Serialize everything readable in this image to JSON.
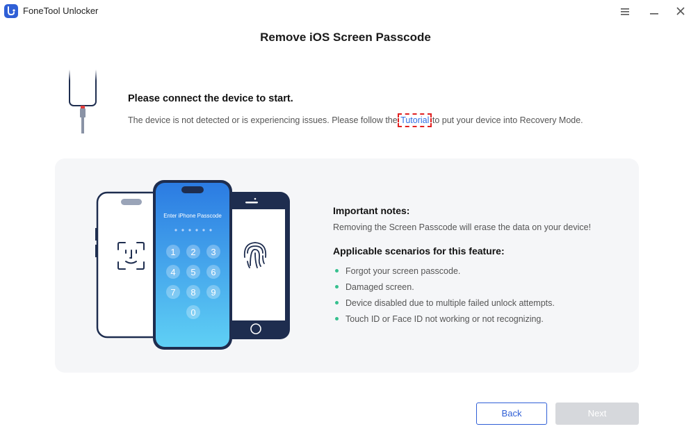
{
  "app": {
    "title": "FoneTool Unlocker",
    "accent": "#2f5fd6"
  },
  "page": {
    "title": "Remove iOS Screen Passcode"
  },
  "connect": {
    "heading": "Please connect the device to start.",
    "desc_before": "The device is not detected or is experiencing issues. Please follow the ",
    "link": "Tutorial",
    "desc_after": " to put your device into Recovery Mode."
  },
  "illustration": {
    "passcode_label": "Enter iPhone Passcode",
    "keys": [
      "1",
      "2",
      "3",
      "4",
      "5",
      "6",
      "7",
      "8",
      "9",
      "0"
    ]
  },
  "notes": {
    "heading": "Important notes:",
    "text": "Removing the Screen Passcode will erase the data on your device!",
    "scenarios_heading": "Applicable scenarios for this feature:",
    "scenarios": [
      "Forgot your screen passcode.",
      "Damaged screen.",
      "Device disabled due to multiple failed unlock attempts.",
      "Touch ID or Face ID not working or not recognizing."
    ],
    "bullet_color": "#36c08e"
  },
  "buttons": {
    "back": "Back",
    "next": "Next"
  },
  "icons": [
    "app-logo-icon",
    "menu-icon",
    "minimize-icon",
    "close-icon",
    "face-id-icon",
    "fingerprint-icon",
    "home-button-icon"
  ]
}
